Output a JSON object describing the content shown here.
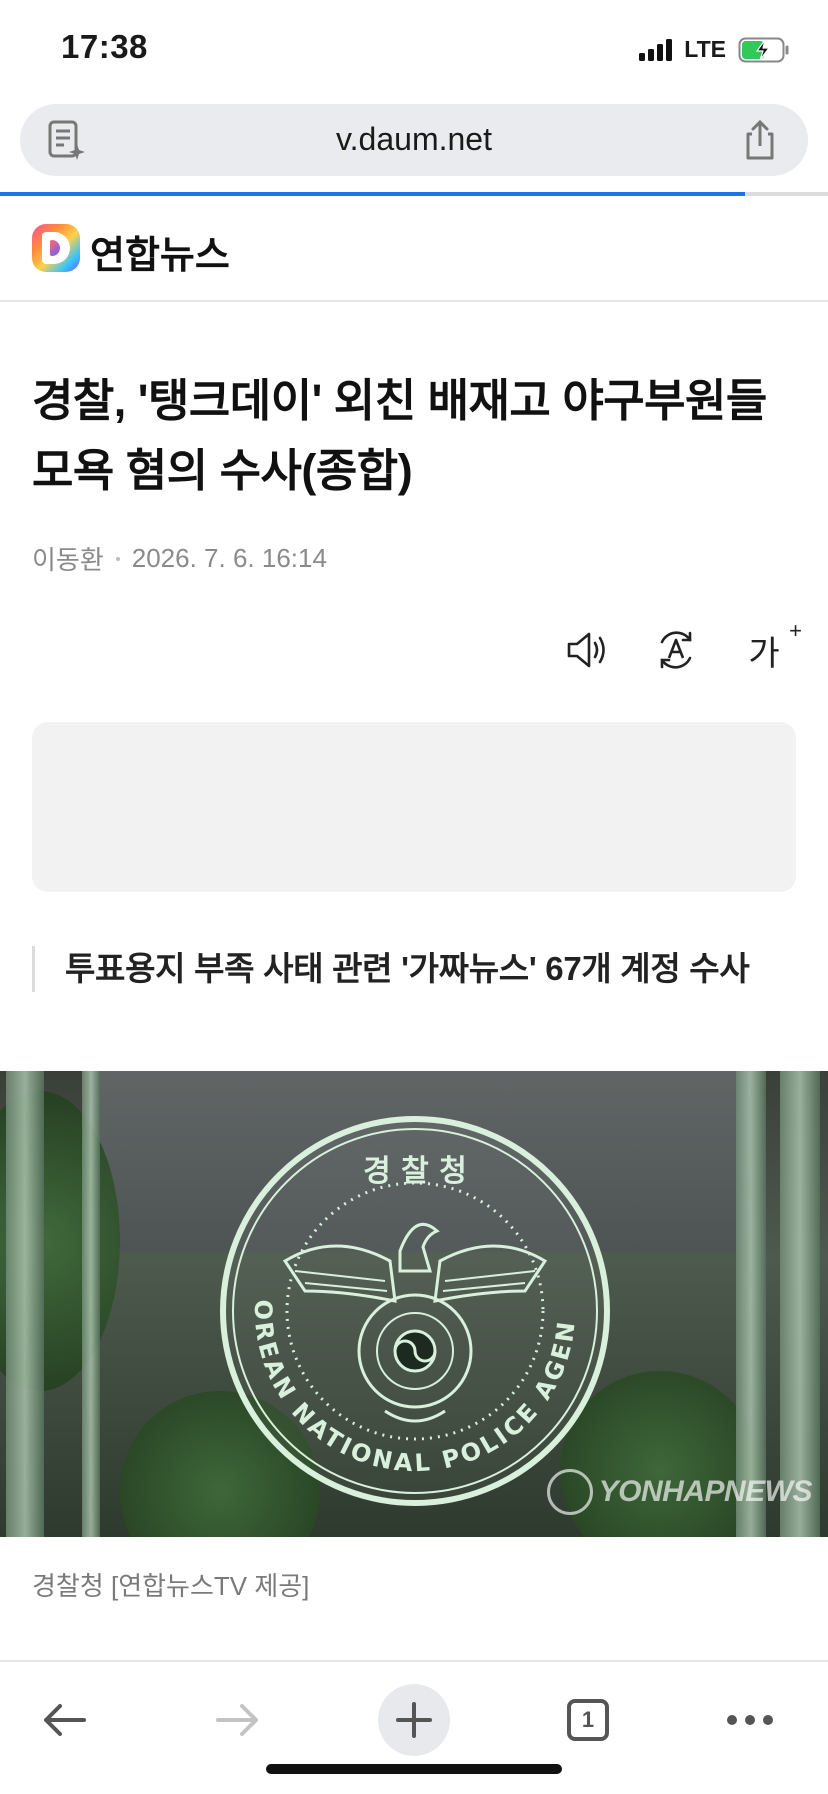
{
  "status": {
    "time": "17:38",
    "network": "LTE"
  },
  "browser": {
    "url": "v.daum.net",
    "load_progress": 0.9,
    "tab_count": "1",
    "icons": {
      "reader": "reader-mode-icon",
      "share": "share-icon",
      "back": "back-arrow-icon",
      "forward": "forward-arrow-icon",
      "new_tab": "plus-icon",
      "tabs": "tabs-icon",
      "more": "more-icon"
    }
  },
  "site": {
    "name": "연합뉴스"
  },
  "article": {
    "headline": "경찰, '탱크데이' 외친 배재고 야구부원들 모욕 혐의 수사(종합)",
    "author": "이동환",
    "date": "2026. 7. 6. 16:14",
    "tools": {
      "audio": "speaker-icon",
      "translate": "translate-icon",
      "font_size": "가"
    },
    "subtitle": "투표용지 부족 사태 관련 '가짜뉴스' 67개 계정 수사",
    "photo": {
      "emblem_top_text": "경 찰 청",
      "emblem_ring_text": "KOREAN NATIONAL POLICE AGENCY",
      "watermark": "YONHAPNEWS"
    },
    "caption": "경찰청 [연합뉴스TV 제공]"
  },
  "colors": {
    "progress": "#1a73e8",
    "url_bar_bg": "#e9ebee",
    "emblem": "#d8f0dc"
  }
}
